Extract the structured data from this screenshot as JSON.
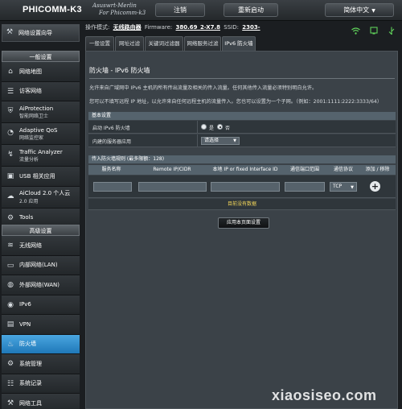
{
  "header": {
    "brand": "PHICOMM-K3",
    "logo_lines": [
      "Asuswrt-Merlin",
      "For Phicomm-k3"
    ],
    "logout": "注销",
    "reboot": "重新启动",
    "language": "简体中文"
  },
  "info": {
    "mode_label": "操作模式:",
    "mode_value": "无线路由器",
    "firmware_label": "Firmware:",
    "firmware_value": "380.69_2-X7.8",
    "ssid_label": "SSID:",
    "ssid_value": "2303-"
  },
  "sidebar": {
    "quick_setup": "网络设置向导",
    "section_general": "一般设置",
    "general_items": [
      {
        "label": "网络地图",
        "sub": ""
      },
      {
        "label": "访客网络",
        "sub": ""
      },
      {
        "label": "AiProtection",
        "sub": "智能网络卫士"
      },
      {
        "label": "Adaptive QoS",
        "sub": "网络监控家"
      },
      {
        "label": "Traffic Analyzer",
        "sub": "流量分析"
      },
      {
        "label": "USB 相关应用",
        "sub": ""
      },
      {
        "label": "AiCloud 2.0 个人云",
        "sub": "2.0 应用"
      },
      {
        "label": "Tools",
        "sub": ""
      }
    ],
    "section_advanced": "高级设置",
    "advanced_items": [
      {
        "label": "无线网络"
      },
      {
        "label": "内部网络(LAN)"
      },
      {
        "label": "外部网络(WAN)"
      },
      {
        "label": "IPv6"
      },
      {
        "label": "VPN"
      },
      {
        "label": "防火墙"
      },
      {
        "label": "系统管理"
      },
      {
        "label": "系统记录"
      },
      {
        "label": "网络工具"
      }
    ]
  },
  "tabs": [
    "一般设置",
    "网址过滤",
    "关键词过滤器",
    "网络服务过滤",
    "IPv6 防火墙"
  ],
  "main": {
    "title": "防火墙 - IPv6 防火墙",
    "desc1": "允许来自广域网中 IPv6 主机的所有传出流量及相关的传入流量。任何其他传入流量必须特别明白允许。",
    "desc2": "您可以不填写远程 IP 地址，以允许来自任何远程主机的流量传入。您也可以设置为一个子网。（例如：2001:1111:2222:3333/64）",
    "basic_header": "基本设置",
    "enable_label": "启动 IPv6 防火墙",
    "radio_yes": "是",
    "radio_no": "否",
    "builtin_label": "内建的服务器应用",
    "builtin_select": "请选择",
    "rules_header": "传入防火墙规则 (最多限额：128)",
    "columns": [
      "服务名称",
      "Remote IP/CIDR",
      "本地 IP or fixed Interface ID",
      "通信端口范围",
      "通信协议",
      "添加 / 移除"
    ],
    "protocol_value": "TCP",
    "add_symbol": "+",
    "empty_text": "目前没有数据",
    "apply_button": "应用本页面设置"
  },
  "watermark": "xiaosiseo.com"
}
